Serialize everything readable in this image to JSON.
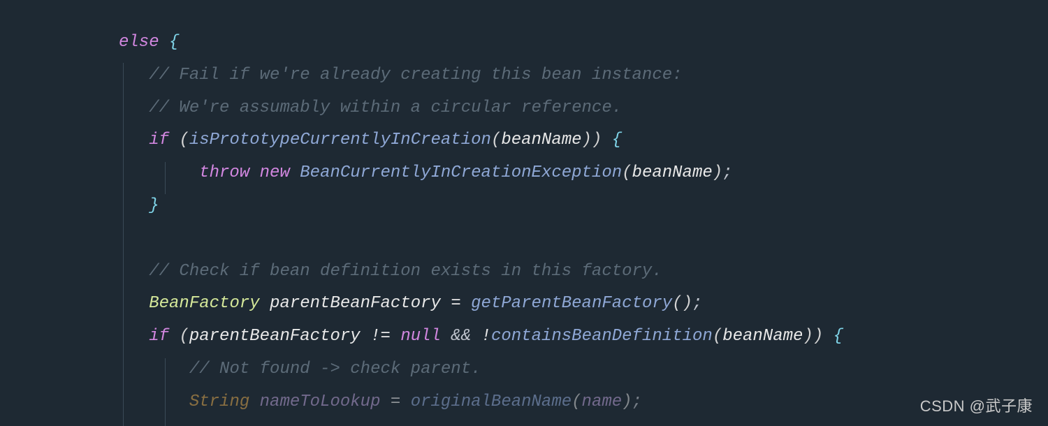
{
  "code": {
    "kw_else": "else",
    "brace_open": "{",
    "brace_close": "}",
    "paren_open": "(",
    "paren_close": ")",
    "semi": ";",
    "comment1": "// Fail if we're already creating this bean instance:",
    "comment2": "// We're assumably within a circular reference.",
    "kw_if": "if",
    "method_isProto": "isPrototypeCurrentlyInCreation",
    "var_beanName": "beanName",
    "kw_throw": "throw",
    "kw_new": "new",
    "class_exception": "BeanCurrentlyInCreationException",
    "comment3": "// Check if bean definition exists in this factory.",
    "class_beanFactory": "BeanFactory",
    "var_parentBeanFactory": "parentBeanFactory",
    "op_assign": "=",
    "method_getParent": "getParentBeanFactory",
    "op_neq": "!=",
    "kw_null": "null",
    "op_andand": "&&",
    "op_not": "!",
    "method_contains": "containsBeanDefinition",
    "comment4": "// Not found -> check parent.",
    "type_string": "String",
    "var_nameToLookup": "nameToLookup",
    "method_original": "originalBeanName",
    "var_name": "name"
  },
  "watermark": "CSDN @武子康"
}
